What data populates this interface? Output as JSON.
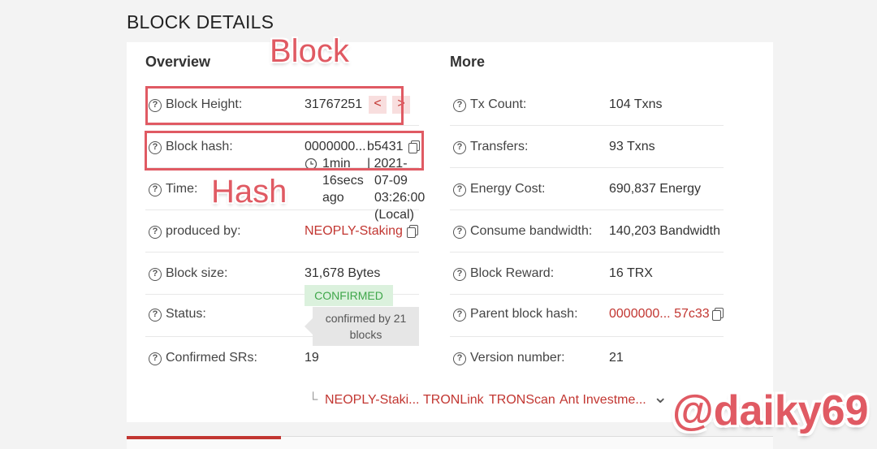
{
  "heading": "BLOCK DETAILS",
  "overview": {
    "title": "Overview",
    "block_height": {
      "label": "Block Height:",
      "value": "31767251",
      "prev": "<",
      "next": ">"
    },
    "block_hash": {
      "label": "Block hash:",
      "value_start": "0000000...",
      "value_end": "b5431"
    },
    "time": {
      "label": "Time:",
      "relative_1": "1min",
      "relative_2": "16secs",
      "relative_3": "ago",
      "abs_1": "| 2021-",
      "abs_2": "07-09",
      "abs_3": "03:26:00",
      "abs_4": "(Local)"
    },
    "produced_by": {
      "label": "produced by:",
      "value": "NEOPLY-Staking"
    },
    "block_size": {
      "label": "Block size:",
      "value": "31,678 Bytes"
    },
    "status": {
      "label": "Status:",
      "badge": "CONFIRMED",
      "tip_line1": "confirmed by 21",
      "tip_line2": "blocks"
    },
    "confirmed_srs": {
      "label": "Confirmed SRs:",
      "value": "19"
    }
  },
  "more": {
    "title": "More",
    "tx_count": {
      "label": "Tx Count:",
      "value": "104 Txns"
    },
    "transfers": {
      "label": "Transfers:",
      "value": "93 Txns"
    },
    "energy_cost": {
      "label": "Energy Cost:",
      "value": "690,837 Energy"
    },
    "consume_bandwidth": {
      "label": "Consume bandwidth:",
      "value": "140,203 Bandwidth"
    },
    "block_reward": {
      "label": "Block Reward:",
      "value": "16 TRX"
    },
    "parent_hash": {
      "label": "Parent block hash:",
      "value": "0000000... 57c33"
    },
    "version": {
      "label": "Version number:",
      "value": "21"
    }
  },
  "srs_list": {
    "corner": "└",
    "items": [
      "NEOPLY-Staki...",
      "TRONLink",
      "TRONScan",
      "Ant Investme..."
    ],
    "expand": "⌄"
  },
  "annotations": {
    "block": "Block",
    "hash": "Hash",
    "watermark": "@daiky69"
  },
  "colors": {
    "accent_red": "#c23631",
    "annotation": "#e05a63",
    "confirmed_green": "#3fa64a"
  },
  "icons": {
    "help": "?"
  }
}
